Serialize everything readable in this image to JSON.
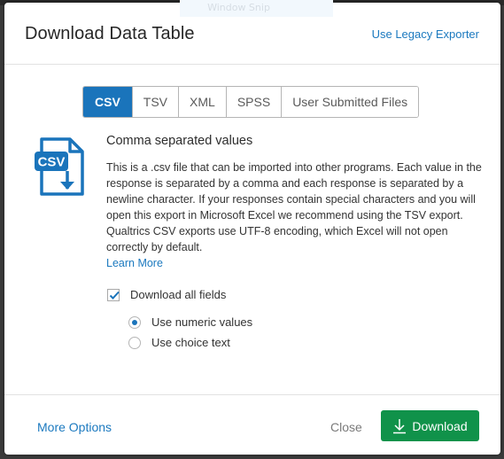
{
  "overlay": {
    "snip_label": "Window Snip"
  },
  "modal": {
    "title": "Download Data Table",
    "legacy_link": "Use Legacy Exporter"
  },
  "tabs": [
    {
      "label": "CSV",
      "active": true
    },
    {
      "label": "TSV",
      "active": false
    },
    {
      "label": "XML",
      "active": false
    },
    {
      "label": "SPSS",
      "active": false
    },
    {
      "label": "User Submitted Files",
      "active": false
    }
  ],
  "format": {
    "icon": "csv-file-download-icon",
    "icon_text": "CSV",
    "title": "Comma separated values",
    "description": "This is a .csv file that can be imported into other programs. Each value in the response is separated by a comma and each response is separated by a newline character. If your responses contain special characters and you will open this export in Microsoft Excel we recommend using the TSV export. Qualtrics CSV exports use UTF-8 encoding, which Excel will not open correctly by default.",
    "learn_more": "Learn More"
  },
  "options": {
    "download_all_fields": {
      "label": "Download all fields",
      "checked": true
    },
    "value_mode": [
      {
        "label": "Use numeric values",
        "selected": true
      },
      {
        "label": "Use choice text",
        "selected": false
      }
    ]
  },
  "footer": {
    "more_options": "More Options",
    "close": "Close",
    "download": "Download"
  },
  "colors": {
    "accent_blue": "#1a74bb",
    "link_blue": "#1b79bf",
    "download_green": "#10924a"
  }
}
